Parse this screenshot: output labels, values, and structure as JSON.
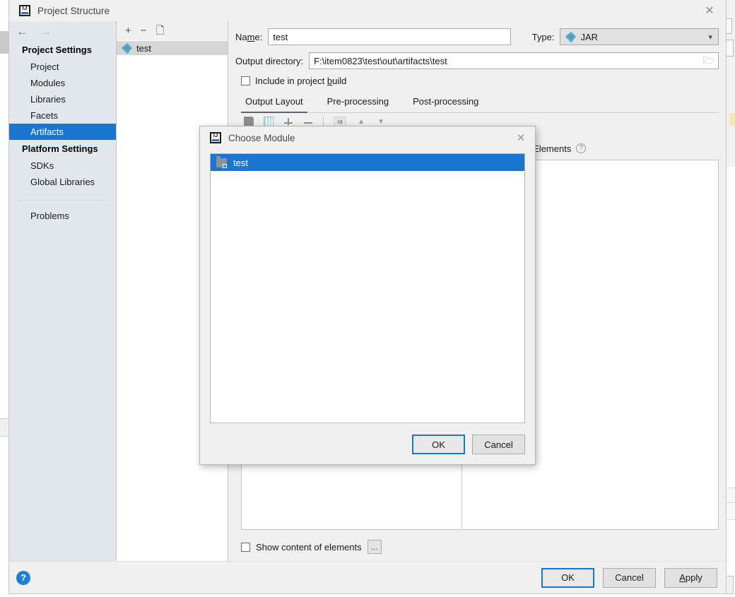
{
  "window": {
    "title": "Project Structure",
    "logo_icon": "intellij-idea-logo-icon",
    "close_icon": "close-icon",
    "back_icon": "arrow-left-icon",
    "forward_icon": "arrow-right-icon"
  },
  "sidebar": {
    "groups": [
      {
        "label": "Project Settings",
        "items": [
          {
            "label": "Project",
            "selected": false
          },
          {
            "label": "Modules",
            "selected": false
          },
          {
            "label": "Libraries",
            "selected": false
          },
          {
            "label": "Facets",
            "selected": false
          },
          {
            "label": "Artifacts",
            "selected": true
          }
        ]
      },
      {
        "label": "Platform Settings",
        "items": [
          {
            "label": "SDKs",
            "selected": false
          },
          {
            "label": "Global Libraries",
            "selected": false
          }
        ]
      }
    ],
    "extra": {
      "label": "Problems"
    }
  },
  "artifacts": {
    "toolbar": {
      "add_icon": "plus-icon",
      "remove_icon": "minus-icon",
      "copy_icon": "copy-icon"
    },
    "items": [
      {
        "label": "test",
        "icon": "artifact-diamond-icon",
        "selected": true
      }
    ]
  },
  "detail": {
    "name_label": "Name:",
    "name_label_pre": "Na",
    "name_label_accel": "m",
    "name_label_post": "e:",
    "name_value": "test",
    "type_label": "Type:",
    "type_value": "JAR",
    "type_icon": "artifact-diamond-icon",
    "type_caret_icon": "chevron-down-icon",
    "output_label": "Output directory:",
    "output_value": "F:\\item0823\\test\\out\\artifacts\\test",
    "output_browse_icon": "folder-icon",
    "include_checkbox_label_pre": "Include in project ",
    "include_checkbox_accel": "b",
    "include_checkbox_label_post": "uild",
    "include_checkbox_checked": false,
    "tabs": [
      {
        "label": "Output Layout",
        "active": true
      },
      {
        "label": "Pre-processing",
        "active": false
      },
      {
        "label": "Post-processing",
        "active": false
      }
    ],
    "layout_toolbar": [
      {
        "icon": "folder-icon"
      },
      {
        "icon": "jar-archive-icon"
      },
      {
        "icon": "add-element-icon"
      },
      {
        "icon": "remove-element-icon"
      },
      {
        "icon": "sort-alphabetically-icon"
      },
      {
        "icon": "move-up-icon"
      },
      {
        "icon": "move-down-icon"
      }
    ],
    "available_elements_label": "Available Elements",
    "available_elements_help_icon": "help-question-icon",
    "show_content_label": "Show content of elements",
    "show_content_checked": false,
    "show_content_more_label": "..."
  },
  "footer": {
    "help_icon": "help-question-icon",
    "buttons": [
      {
        "label": "OK",
        "default": true,
        "accel": null
      },
      {
        "label": "Cancel",
        "default": false,
        "accel": null
      },
      {
        "label": "Apply",
        "default": false,
        "accel": "A"
      }
    ]
  },
  "modal": {
    "title": "Choose Module",
    "logo_icon": "intellij-idea-logo-icon",
    "close_icon": "close-icon",
    "list": [
      {
        "label": "test",
        "icon": "module-folder-icon",
        "selected": true
      }
    ],
    "buttons": [
      {
        "label": "OK",
        "default": true
      },
      {
        "label": "Cancel",
        "default": false
      }
    ]
  },
  "colors": {
    "accent_blue": "#1977d3",
    "window_bg": "#f0f0f0",
    "sidebar_bg": "#e3e8ec",
    "selection_blue": "#1977d3"
  }
}
